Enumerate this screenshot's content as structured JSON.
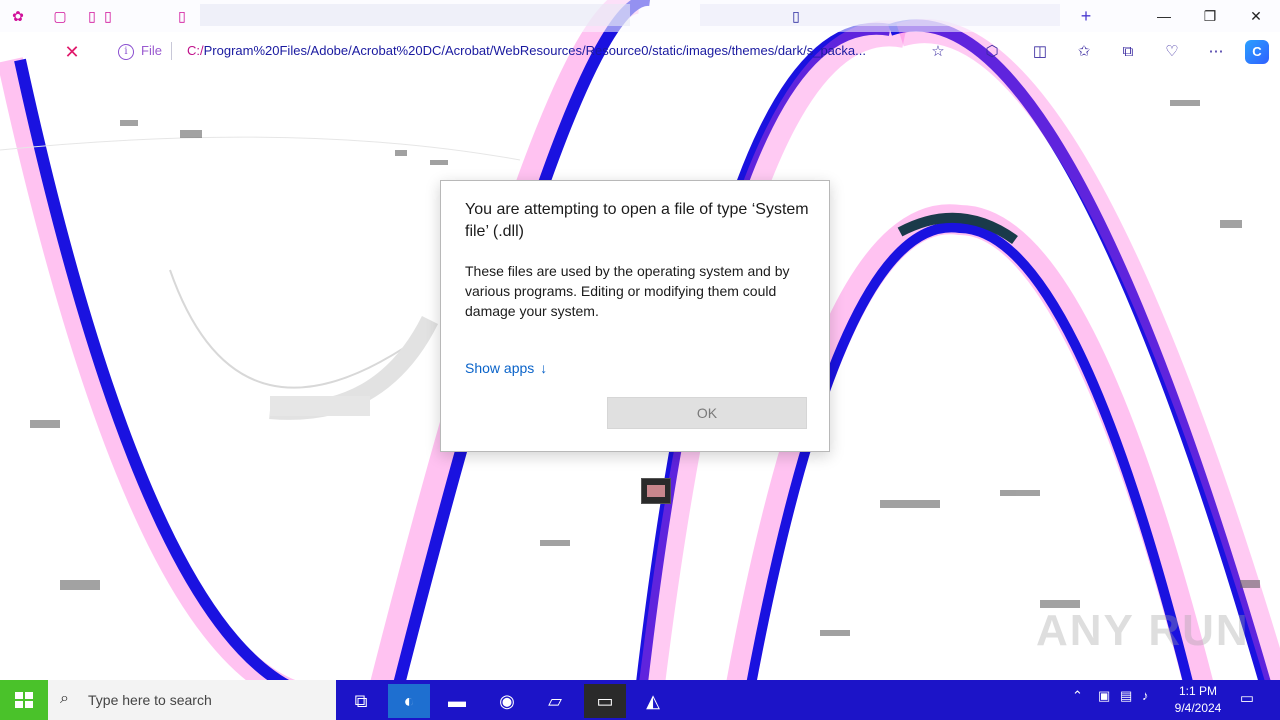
{
  "browser": {
    "address": {
      "protocol_label": "File",
      "url": "C:/Program%20Files/Adobe/Acrobat%20DC/Acrobat/WebResources/Resource0/static/images/themes/dark/s_packa..."
    },
    "window_controls": {
      "new_tab": "+",
      "minimize": "—",
      "restore": "❐",
      "close": "✕"
    }
  },
  "dialog": {
    "title": "You are attempting to open a file of type ‘System file’ (.dll)",
    "body": "These files are used by the operating system and by various programs. Editing or modifying them could damage your system.",
    "show_apps_label": "Show apps",
    "show_apps_arrow": "↓",
    "ok_label": "OK"
  },
  "watermark": {
    "text": "ANY RUN"
  },
  "taskbar": {
    "search_placeholder": "Type here to search",
    "clock_time": "1:1 PM",
    "clock_date": "9/4/2024",
    "colors": {
      "taskbar": "#1c14c8",
      "start": "#4ac22a"
    }
  }
}
